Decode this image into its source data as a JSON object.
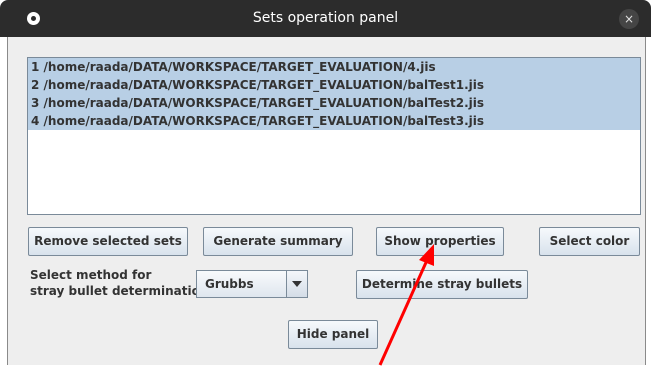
{
  "window": {
    "title": "Sets operation panel",
    "close_label": "×"
  },
  "sets_list": {
    "items": [
      {
        "label": "1 /home/raada/DATA/WORKSPACE/TARGET_EVALUATION/4.jis"
      },
      {
        "label": "2 /home/raada/DATA/WORKSPACE/TARGET_EVALUATION/balTest1.jis"
      },
      {
        "label": "3 /home/raada/DATA/WORKSPACE/TARGET_EVALUATION/balTest2.jis"
      },
      {
        "label": "4 /home/raada/DATA/WORKSPACE/TARGET_EVALUATION/balTest3.jis"
      }
    ],
    "selected_color": "#b8cfe5"
  },
  "actions": {
    "remove_label": "Remove selected sets",
    "summary_label": "Generate summary",
    "properties_label": "Show properties",
    "color_label": "Select color"
  },
  "method": {
    "label_line1": "Select method for",
    "label_line2": "stray bullet determination",
    "selected": "Grubbs",
    "determine_label": "Determine stray bullets"
  },
  "footer": {
    "hide_label": "Hide panel"
  },
  "annotation": {
    "arrow_color": "#ff0000"
  }
}
